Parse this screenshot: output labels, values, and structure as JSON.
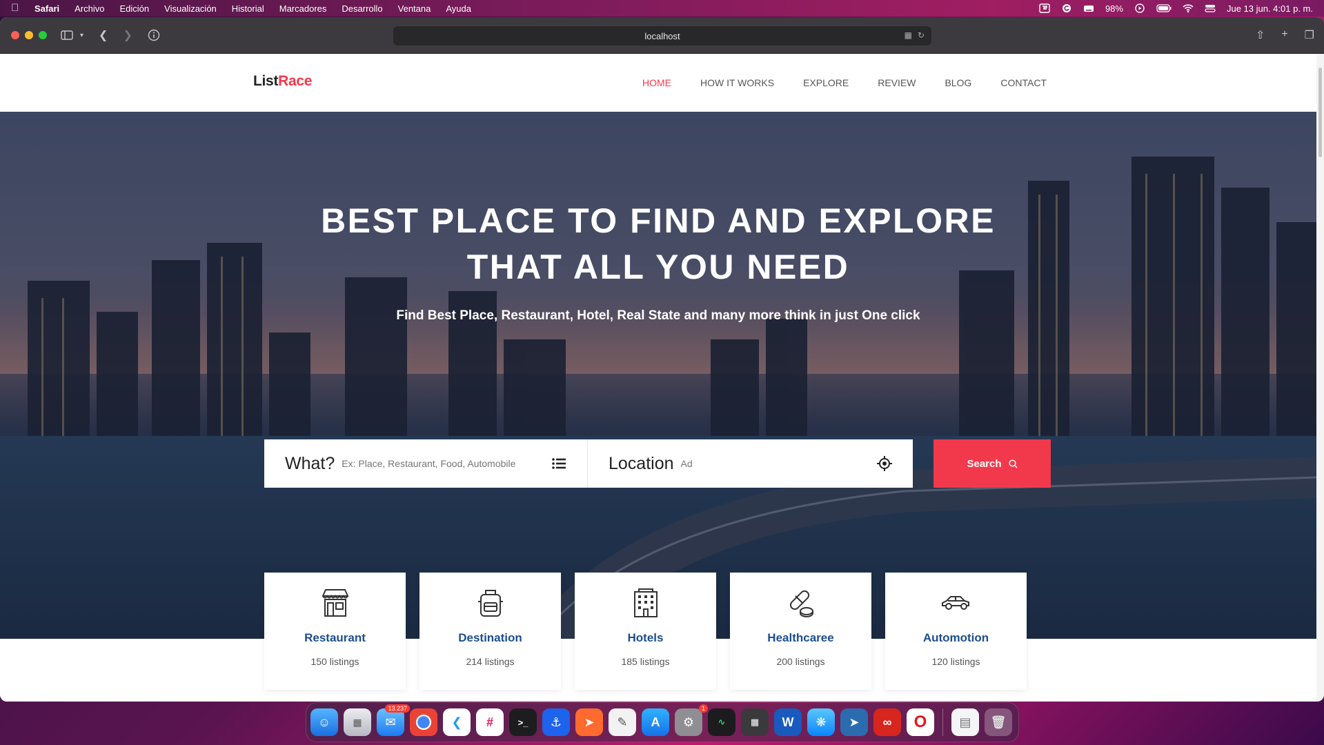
{
  "menubar": {
    "app_name": "Safari",
    "menus": [
      "Archivo",
      "Edición",
      "Visualización",
      "Historial",
      "Marcadores",
      "Desarrollo",
      "Ventana",
      "Ayuda"
    ],
    "battery": "98%",
    "datetime": "Jue 13 jun.  4:01 p. m."
  },
  "browser": {
    "url": "localhost"
  },
  "site": {
    "logo_primary": "List",
    "logo_accent": "Race",
    "nav": [
      "HOME",
      "HOW IT WORKS",
      "EXPLORE",
      "REVIEW",
      "BLOG",
      "CONTACT"
    ],
    "nav_active": "HOME",
    "hero_title_line1": "BEST PLACE TO FIND AND EXPLORE",
    "hero_title_line2": "THAT ALL YOU NEED",
    "hero_subtitle": "Find Best Place, Restaurant, Hotel, Real State and many more think in just One click",
    "search": {
      "what_label": "What?",
      "what_placeholder": "Ex: Place, Restaurant, Food, Automobile",
      "location_label": "Location",
      "location_value": "Ad",
      "button_label": "Search"
    },
    "categories": [
      {
        "name": "Restaurant",
        "count": "150 listings",
        "icon": "store-icon"
      },
      {
        "name": "Destination",
        "count": "214 listings",
        "icon": "backpack-icon"
      },
      {
        "name": "Hotels",
        "count": "185 listings",
        "icon": "building-icon"
      },
      {
        "name": "Healthcaree",
        "count": "200 listings",
        "icon": "pills-icon"
      },
      {
        "name": "Automotion",
        "count": "120 listings",
        "icon": "car-icon"
      }
    ]
  },
  "dock": {
    "mail_badge": "13.237",
    "settings_badge": "1"
  },
  "colors": {
    "accent": "#f2394c",
    "category_title": "#1c4e8e"
  }
}
